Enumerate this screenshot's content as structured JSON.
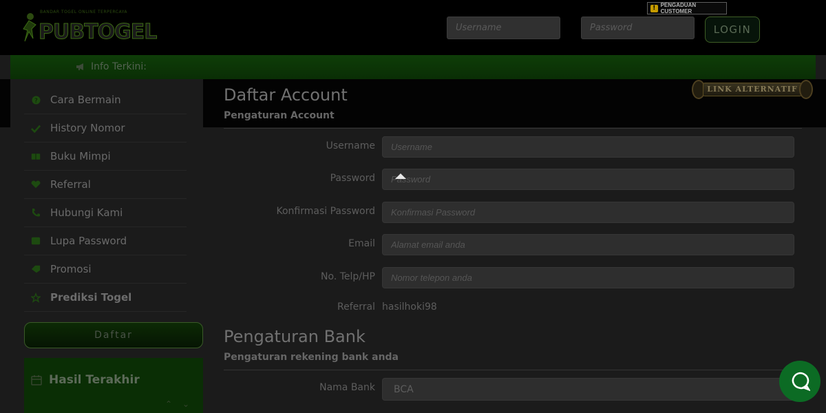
{
  "header": {
    "logo_text": "PUBTOGEL",
    "logo_tagline": "BANDAR TOGEL ONLINE TERPERCAYA",
    "username_placeholder": "Username",
    "password_placeholder": "Password",
    "login_label": "LOGIN",
    "complaint_label": "PENGADUAN CUSTOMER"
  },
  "infobar": {
    "label": "Info Terkini:"
  },
  "link_alternatif": "LINK ALTERNATIF",
  "sidebar": {
    "items": [
      {
        "label": "Cara Bermain",
        "icon": "question-icon"
      },
      {
        "label": "History Nomor",
        "icon": "check-icon"
      },
      {
        "label": "Buku Mimpi",
        "icon": "book-icon"
      },
      {
        "label": "Referral",
        "icon": "heart-icon"
      },
      {
        "label": "Hubungi Kami",
        "icon": "phone-icon"
      },
      {
        "label": "Lupa Password",
        "icon": "key-icon"
      },
      {
        "label": "Promosi",
        "icon": "tag-icon"
      },
      {
        "label": "Prediksi Togel",
        "icon": "star-icon"
      }
    ],
    "daftar_label": "Daftar",
    "hasil_label": "Hasil Terakhir"
  },
  "account": {
    "title": "Daftar Account",
    "subtitle": "Pengaturan Account",
    "username_label": "Username",
    "username_placeholder": "Username",
    "password_label": "Password",
    "password_placeholder": "Password",
    "confirm_label": "Konfirmasi Password",
    "confirm_placeholder": "Konfirmasi Password",
    "email_label": "Email",
    "email_placeholder": "Alamat email anda",
    "phone_label": "No. Telp/HP",
    "phone_placeholder": "Nomor telepon anda",
    "referral_label": "Referral",
    "referral_value": "hasilhoki98"
  },
  "bank": {
    "title": "Pengaturan Bank",
    "subtitle": "Pengaturan rekening bank anda",
    "bank_label": "Nama Bank",
    "bank_value": "BCA"
  },
  "colors": {
    "accent": "#0c6b24",
    "bg": "#1b1b1b",
    "header": "#000000"
  }
}
